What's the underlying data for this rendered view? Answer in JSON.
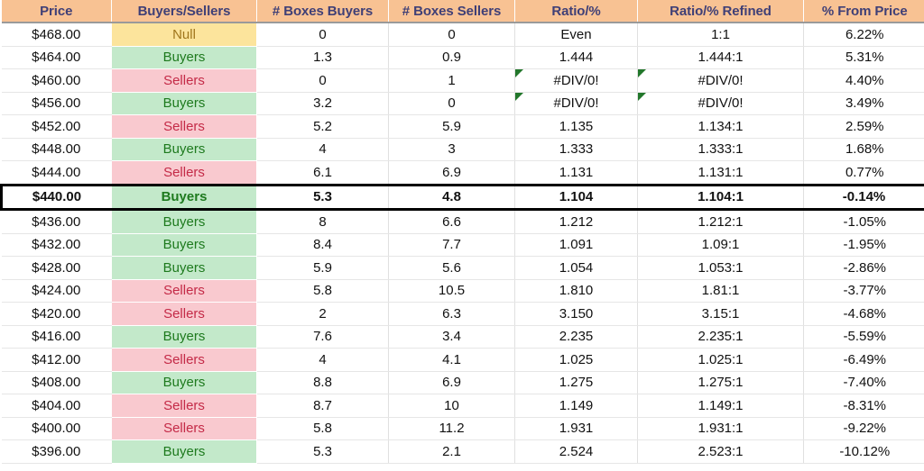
{
  "table": {
    "columns": [
      {
        "key": "price",
        "label": "Price"
      },
      {
        "key": "bs",
        "label": "Buyers/Sellers"
      },
      {
        "key": "bb",
        "label": "# Boxes Buyers"
      },
      {
        "key": "bsell",
        "label": "# Boxes Sellers"
      },
      {
        "key": "ratio",
        "label": "Ratio/%"
      },
      {
        "key": "refined",
        "label": "Ratio/% Refined"
      },
      {
        "key": "pct",
        "label": "% From Price"
      }
    ],
    "header_bg": "#F8C293",
    "header_fg": "#3F3F76",
    "status_colors": {
      "null_bg": "#FCE49C",
      "null_fg": "#A0761C",
      "buyers_bg": "#C3E9CA",
      "buyers_fg": "#1E7A1E",
      "sellers_bg": "#F9C9CF",
      "sellers_fg": "#C42A47"
    },
    "highlight_row_price": "$440.00",
    "rows": [
      {
        "price": "$468.00",
        "bs": "Null",
        "status": "null",
        "bb": "0",
        "bsell": "0",
        "ratio": "Even",
        "refined": "1:1",
        "pct": "6.22%",
        "error": false,
        "highlight": false
      },
      {
        "price": "$464.00",
        "bs": "Buyers",
        "status": "buyers",
        "bb": "1.3",
        "bsell": "0.9",
        "ratio": "1.444",
        "refined": "1.444:1",
        "pct": "5.31%",
        "error": false,
        "highlight": false
      },
      {
        "price": "$460.00",
        "bs": "Sellers",
        "status": "sellers",
        "bb": "0",
        "bsell": "1",
        "ratio": "#DIV/0!",
        "refined": "#DIV/0!",
        "pct": "4.40%",
        "error": true,
        "highlight": false
      },
      {
        "price": "$456.00",
        "bs": "Buyers",
        "status": "buyers",
        "bb": "3.2",
        "bsell": "0",
        "ratio": "#DIV/0!",
        "refined": "#DIV/0!",
        "pct": "3.49%",
        "error": true,
        "highlight": false
      },
      {
        "price": "$452.00",
        "bs": "Sellers",
        "status": "sellers",
        "bb": "5.2",
        "bsell": "5.9",
        "ratio": "1.135",
        "refined": "1.134:1",
        "pct": "2.59%",
        "error": false,
        "highlight": false
      },
      {
        "price": "$448.00",
        "bs": "Buyers",
        "status": "buyers",
        "bb": "4",
        "bsell": "3",
        "ratio": "1.333",
        "refined": "1.333:1",
        "pct": "1.68%",
        "error": false,
        "highlight": false
      },
      {
        "price": "$444.00",
        "bs": "Sellers",
        "status": "sellers",
        "bb": "6.1",
        "bsell": "6.9",
        "ratio": "1.131",
        "refined": "1.131:1",
        "pct": "0.77%",
        "error": false,
        "highlight": false
      },
      {
        "price": "$440.00",
        "bs": "Buyers",
        "status": "buyers",
        "bb": "5.3",
        "bsell": "4.8",
        "ratio": "1.104",
        "refined": "1.104:1",
        "pct": "-0.14%",
        "error": false,
        "highlight": true
      },
      {
        "price": "$436.00",
        "bs": "Buyers",
        "status": "buyers",
        "bb": "8",
        "bsell": "6.6",
        "ratio": "1.212",
        "refined": "1.212:1",
        "pct": "-1.05%",
        "error": false,
        "highlight": false
      },
      {
        "price": "$432.00",
        "bs": "Buyers",
        "status": "buyers",
        "bb": "8.4",
        "bsell": "7.7",
        "ratio": "1.091",
        "refined": "1.09:1",
        "pct": "-1.95%",
        "error": false,
        "highlight": false
      },
      {
        "price": "$428.00",
        "bs": "Buyers",
        "status": "buyers",
        "bb": "5.9",
        "bsell": "5.6",
        "ratio": "1.054",
        "refined": "1.053:1",
        "pct": "-2.86%",
        "error": false,
        "highlight": false
      },
      {
        "price": "$424.00",
        "bs": "Sellers",
        "status": "sellers",
        "bb": "5.8",
        "bsell": "10.5",
        "ratio": "1.810",
        "refined": "1.81:1",
        "pct": "-3.77%",
        "error": false,
        "highlight": false
      },
      {
        "price": "$420.00",
        "bs": "Sellers",
        "status": "sellers",
        "bb": "2",
        "bsell": "6.3",
        "ratio": "3.150",
        "refined": "3.15:1",
        "pct": "-4.68%",
        "error": false,
        "highlight": false
      },
      {
        "price": "$416.00",
        "bs": "Buyers",
        "status": "buyers",
        "bb": "7.6",
        "bsell": "3.4",
        "ratio": "2.235",
        "refined": "2.235:1",
        "pct": "-5.59%",
        "error": false,
        "highlight": false
      },
      {
        "price": "$412.00",
        "bs": "Sellers",
        "status": "sellers",
        "bb": "4",
        "bsell": "4.1",
        "ratio": "1.025",
        "refined": "1.025:1",
        "pct": "-6.49%",
        "error": false,
        "highlight": false
      },
      {
        "price": "$408.00",
        "bs": "Buyers",
        "status": "buyers",
        "bb": "8.8",
        "bsell": "6.9",
        "ratio": "1.275",
        "refined": "1.275:1",
        "pct": "-7.40%",
        "error": false,
        "highlight": false
      },
      {
        "price": "$404.00",
        "bs": "Sellers",
        "status": "sellers",
        "bb": "8.7",
        "bsell": "10",
        "ratio": "1.149",
        "refined": "1.149:1",
        "pct": "-8.31%",
        "error": false,
        "highlight": false
      },
      {
        "price": "$400.00",
        "bs": "Sellers",
        "status": "sellers",
        "bb": "5.8",
        "bsell": "11.2",
        "ratio": "1.931",
        "refined": "1.931:1",
        "pct": "-9.22%",
        "error": false,
        "highlight": false
      },
      {
        "price": "$396.00",
        "bs": "Buyers",
        "status": "buyers",
        "bb": "5.3",
        "bsell": "2.1",
        "ratio": "2.524",
        "refined": "2.523:1",
        "pct": "-10.12%",
        "error": false,
        "highlight": false
      }
    ]
  }
}
